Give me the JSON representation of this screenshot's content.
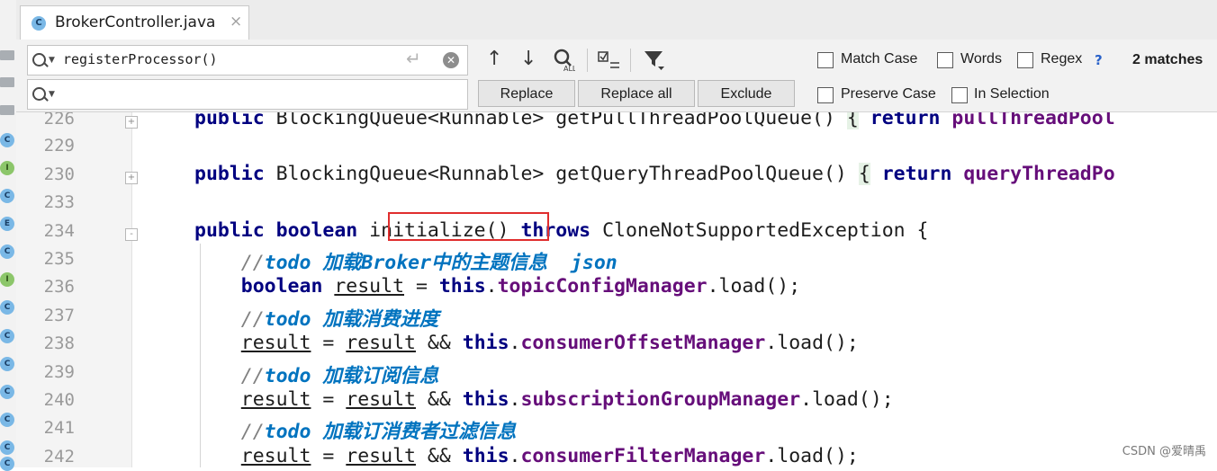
{
  "tab": {
    "icon_letter": "C",
    "title": "BrokerController.java",
    "close_glyph": "×"
  },
  "find": {
    "query": "registerProcessor()",
    "replace_value": "",
    "buttons": {
      "replace": "Replace",
      "replace_all": "Replace all",
      "exclude": "Exclude"
    },
    "options": {
      "match_case": "Match Case",
      "words": "Words",
      "regex": "Regex",
      "help": "?",
      "preserve_case": "Preserve Case",
      "in_selection": "In Selection"
    },
    "matches": "2 matches"
  },
  "project_strip": [
    "folder",
    "folder",
    "folder",
    "C",
    "I",
    "C",
    "E",
    "C",
    "I",
    "C",
    "C",
    "C",
    "C",
    "C",
    "C",
    "C"
  ],
  "editor": {
    "line_numbers": [
      "226",
      "229",
      "230",
      "233",
      "234",
      "235",
      "236",
      "237",
      "238",
      "239",
      "240",
      "241",
      "242"
    ],
    "lines": [
      [
        {
          "t": "public",
          "c": "kw"
        },
        {
          "t": " BlockingQueue<Runnable> getPullThreadPoolQueue() ",
          "c": ""
        },
        {
          "t": "{",
          "c": "brace"
        },
        {
          "t": " ",
          "c": ""
        },
        {
          "t": "return",
          "c": "kw"
        },
        {
          "t": " ",
          "c": ""
        },
        {
          "t": "pullThreadPool",
          "c": "fld"
        }
      ],
      [],
      [
        {
          "t": "public",
          "c": "kw"
        },
        {
          "t": " BlockingQueue<Runnable> getQueryThreadPoolQueue() ",
          "c": ""
        },
        {
          "t": "{",
          "c": "brace"
        },
        {
          "t": " ",
          "c": ""
        },
        {
          "t": "return",
          "c": "kw"
        },
        {
          "t": " ",
          "c": ""
        },
        {
          "t": "queryThreadPo",
          "c": "fld"
        }
      ],
      [],
      [
        {
          "t": "public",
          "c": "kw"
        },
        {
          "t": " ",
          "c": ""
        },
        {
          "t": "boolean",
          "c": "kw"
        },
        {
          "t": " initialize() ",
          "c": ""
        },
        {
          "t": "throws",
          "c": "kw"
        },
        {
          "t": " CloneNotSupportedException {",
          "c": ""
        }
      ],
      [
        {
          "t": "    //",
          "c": "cm"
        },
        {
          "t": "todo 加载Broker中的主题信息  json",
          "c": "todo"
        }
      ],
      [
        {
          "t": "    ",
          "c": ""
        },
        {
          "t": "boolean",
          "c": "kw"
        },
        {
          "t": " ",
          "c": ""
        },
        {
          "t": "result",
          "c": "ul"
        },
        {
          "t": " = ",
          "c": ""
        },
        {
          "t": "this",
          "c": "kw"
        },
        {
          "t": ".",
          "c": ""
        },
        {
          "t": "topicConfigManager",
          "c": "fld"
        },
        {
          "t": ".load();",
          "c": ""
        }
      ],
      [
        {
          "t": "    //",
          "c": "cm"
        },
        {
          "t": "todo 加载消费进度",
          "c": "todo"
        }
      ],
      [
        {
          "t": "    ",
          "c": ""
        },
        {
          "t": "result",
          "c": "ul"
        },
        {
          "t": " = ",
          "c": ""
        },
        {
          "t": "result",
          "c": "ul"
        },
        {
          "t": " && ",
          "c": ""
        },
        {
          "t": "this",
          "c": "kw"
        },
        {
          "t": ".",
          "c": ""
        },
        {
          "t": "consumerOffsetManager",
          "c": "fld"
        },
        {
          "t": ".load();",
          "c": ""
        }
      ],
      [
        {
          "t": "    //",
          "c": "cm"
        },
        {
          "t": "todo 加载订阅信息",
          "c": "todo"
        }
      ],
      [
        {
          "t": "    ",
          "c": ""
        },
        {
          "t": "result",
          "c": "ul"
        },
        {
          "t": " = ",
          "c": ""
        },
        {
          "t": "result",
          "c": "ul"
        },
        {
          "t": " && ",
          "c": ""
        },
        {
          "t": "this",
          "c": "kw"
        },
        {
          "t": ".",
          "c": ""
        },
        {
          "t": "subscriptionGroupManager",
          "c": "fld"
        },
        {
          "t": ".load();",
          "c": ""
        }
      ],
      [
        {
          "t": "    //",
          "c": "cm"
        },
        {
          "t": "todo 加载订消费者过滤信息",
          "c": "todo"
        }
      ],
      [
        {
          "t": "    ",
          "c": ""
        },
        {
          "t": "result",
          "c": "ul"
        },
        {
          "t": " = ",
          "c": ""
        },
        {
          "t": "result",
          "c": "ul"
        },
        {
          "t": " && ",
          "c": ""
        },
        {
          "t": "this",
          "c": "kw"
        },
        {
          "t": ".",
          "c": ""
        },
        {
          "t": "consumerFilterManager",
          "c": "fld"
        },
        {
          "t": ".load();",
          "c": ""
        }
      ]
    ]
  },
  "watermark": "CSDN @爱晴禹",
  "colors": {
    "keyword": "#000080",
    "field": "#660e7a",
    "todo": "#0073bf",
    "highlight_box": "#e02d2d"
  }
}
